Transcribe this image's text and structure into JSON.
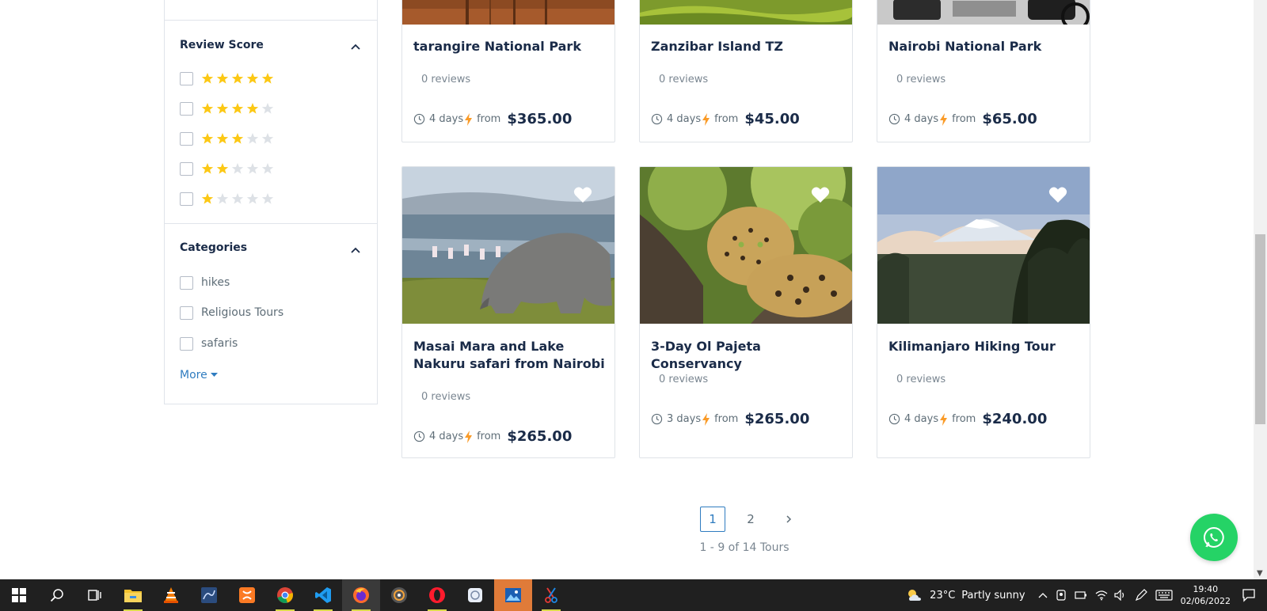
{
  "sidebar": {
    "review_title": "Review Score",
    "review_rows": [
      {
        "stars": 5
      },
      {
        "stars": 4
      },
      {
        "stars": 3
      },
      {
        "stars": 2
      },
      {
        "stars": 1
      }
    ],
    "categories_title": "Categories",
    "categories": [
      "hikes",
      "Religious Tours",
      "safaris"
    ],
    "more_label": "More"
  },
  "tours": [
    {
      "title": "tarangire National Park",
      "reviews": "0 reviews",
      "duration": "4 days",
      "from": "from",
      "price": "$365.00"
    },
    {
      "title": "Zanzibar Island TZ",
      "reviews": "0 reviews",
      "duration": "4 days",
      "from": "from",
      "price": "$45.00"
    },
    {
      "title": "Nairobi National Park",
      "reviews": "0 reviews",
      "duration": "4 days",
      "from": "from",
      "price": "$65.00"
    },
    {
      "title": "Masai Mara and Lake Nakuru safari from Nairobi",
      "reviews": "0 reviews",
      "duration": "4 days",
      "from": "from",
      "price": "$265.00"
    },
    {
      "title": "3-Day Ol Pajeta Conservancy",
      "reviews": "0 reviews",
      "duration": "3 days",
      "from": "from",
      "price": "$265.00"
    },
    {
      "title": "Kilimanjaro Hiking Tour",
      "reviews": "0 reviews",
      "duration": "4 days",
      "from": "from",
      "price": "$240.00"
    }
  ],
  "pagination": {
    "pages": [
      "1",
      "2"
    ],
    "current": "1",
    "summary": "1 - 9 of 14 Tours"
  },
  "colors": {
    "accent": "#2f7cc0",
    "star_on": "#fcc814",
    "star_off": "#dde1e6",
    "whatsapp": "#25d366",
    "bolt": "#fa9b28"
  },
  "taskbar": {
    "apps": [
      "start-icon",
      "search-icon",
      "task-view-icon",
      "file-explorer-icon",
      "vlc-icon",
      "mysql-workbench-icon",
      "xampp-icon",
      "chrome-icon",
      "vscode-icon",
      "firefox-icon",
      "media-player-icon",
      "opera-icon",
      "app-icon",
      "photos-icon",
      "snipping-tool-icon"
    ],
    "weather_temp": "23°C",
    "weather_desc": "Partly sunny",
    "time": "19:40",
    "date": "02/06/2022"
  }
}
